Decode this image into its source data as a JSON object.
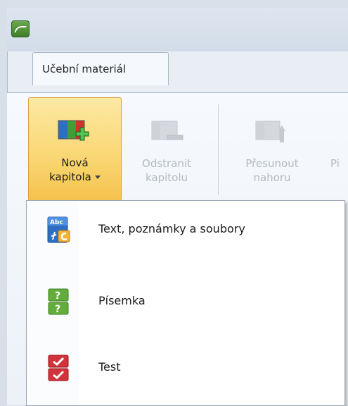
{
  "window": {
    "tab_label": "Učební materiál"
  },
  "ribbon": {
    "new_chapter": {
      "line1": "Nová",
      "line2": "kapitola"
    },
    "remove_chapter": {
      "line1": "Odstranit",
      "line2": "kapitolu"
    },
    "move_up": {
      "line1": "Přesunout",
      "line2": "nahoru"
    },
    "partial": {
      "line1": "Pi"
    }
  },
  "menu": {
    "items": [
      {
        "label": "Text, poznámky a soubory",
        "icon": "text-notes-files-icon"
      },
      {
        "label": "Písemka",
        "icon": "written-test-icon"
      },
      {
        "label": "Test",
        "icon": "test-icon"
      }
    ]
  },
  "colors": {
    "ribbon_highlight": "#f9d672",
    "disabled_text": "#b4b9c0",
    "menu_bg": "#ffffff"
  }
}
